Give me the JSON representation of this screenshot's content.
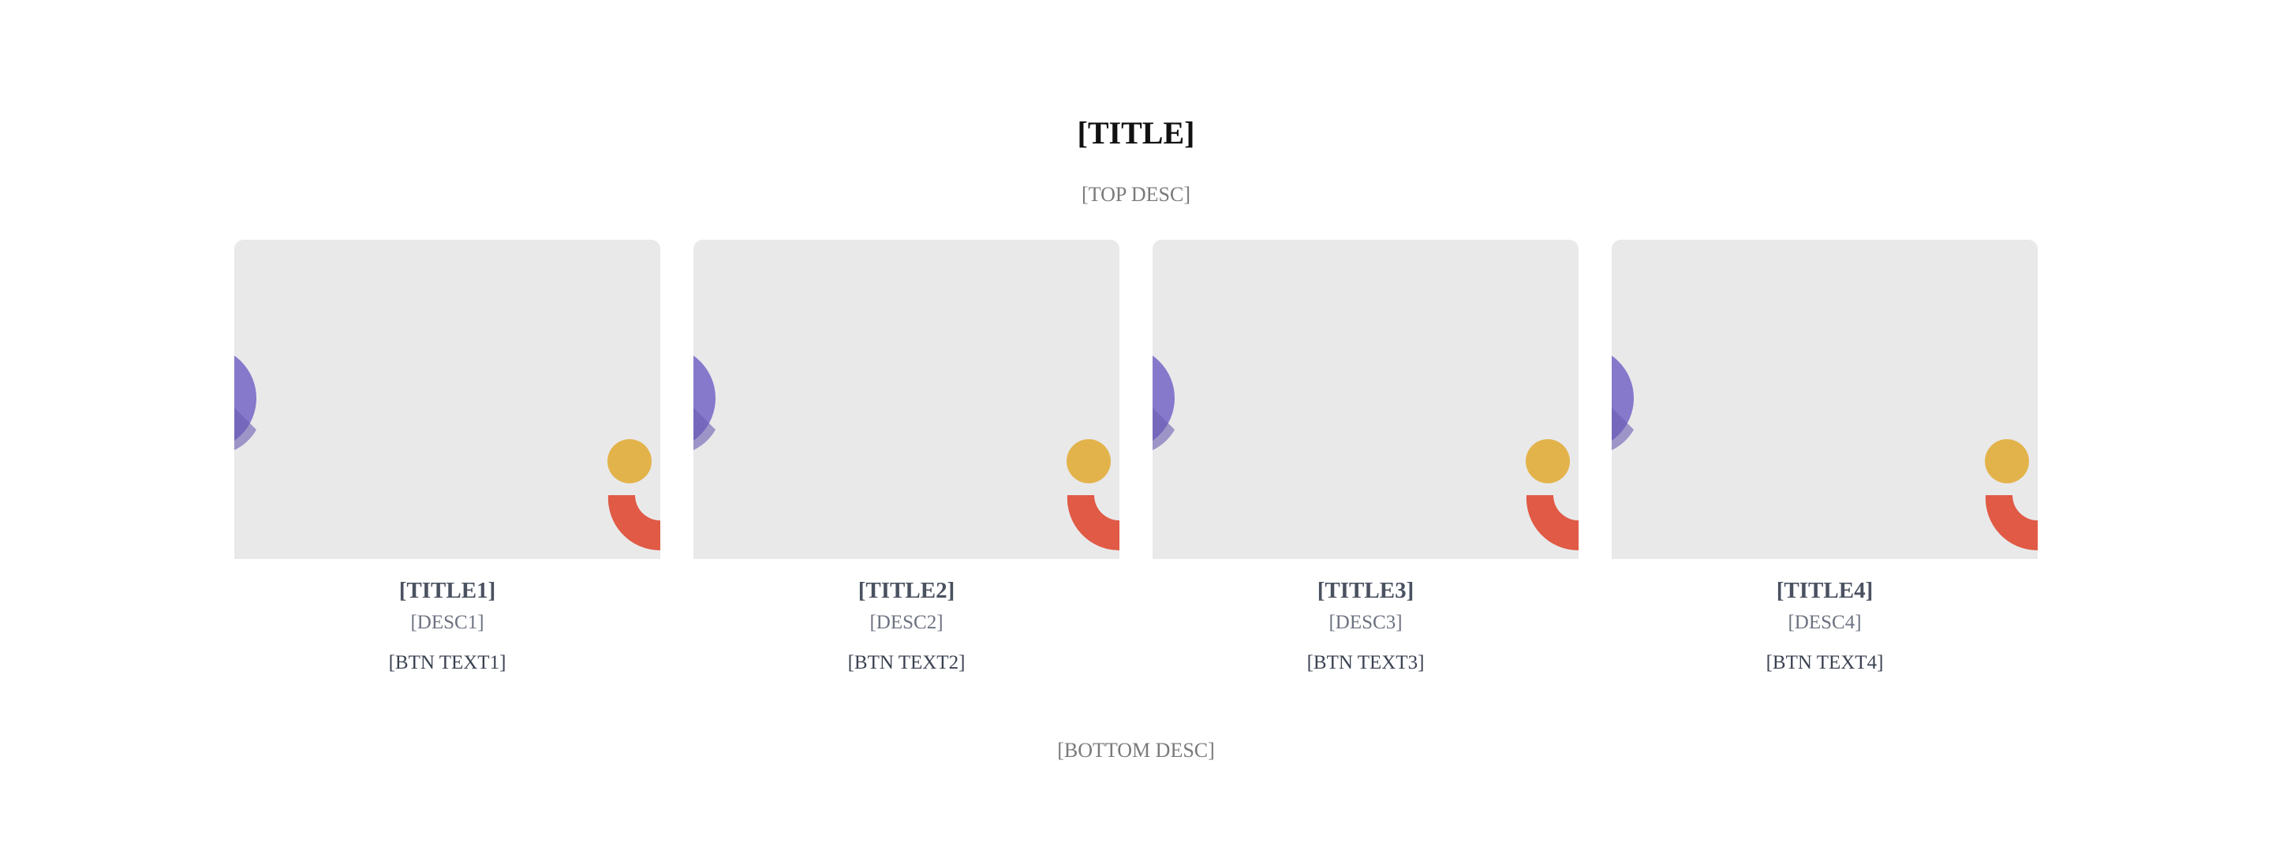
{
  "header": {
    "title": "[TITLE]",
    "top_desc": "[TOP DESC]"
  },
  "cards": [
    {
      "title": "[TITLE1]",
      "desc": "[DESC1]",
      "button": "[BTN TEXT1]"
    },
    {
      "title": "[TITLE2]",
      "desc": "[DESC2]",
      "button": "[BTN TEXT2]"
    },
    {
      "title": "[TITLE3]",
      "desc": "[DESC3]",
      "button": "[BTN TEXT3]"
    },
    {
      "title": "[TITLE4]",
      "desc": "[DESC4]",
      "button": "[BTN TEXT4]"
    }
  ],
  "footer": {
    "bottom_desc": "[BOTTOM DESC]"
  },
  "colors": {
    "card_background": "#e9e9ea",
    "purple_shape": "#8679cc",
    "yellow_dot": "#e3b34b",
    "red_arc": "#e05a45"
  }
}
